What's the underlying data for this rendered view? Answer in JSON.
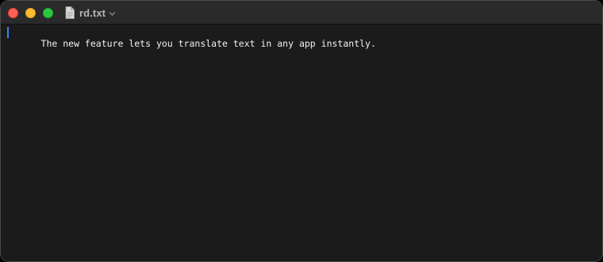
{
  "window": {
    "title": "rd.txt",
    "traffic_lights": [
      {
        "name": "close",
        "color": "#ff5f57"
      },
      {
        "name": "minimize",
        "color": "#febc2e"
      },
      {
        "name": "zoom",
        "color": "#28c840"
      }
    ],
    "title_icon": "document-icon",
    "title_menu_icon": "chevron-down-icon"
  },
  "editor": {
    "lines": [
      "The new feature lets you translate text in any app instantly."
    ],
    "caret_color": "#3b82f6",
    "background": "#1b1b1b",
    "text_color": "#f2f2f2"
  }
}
